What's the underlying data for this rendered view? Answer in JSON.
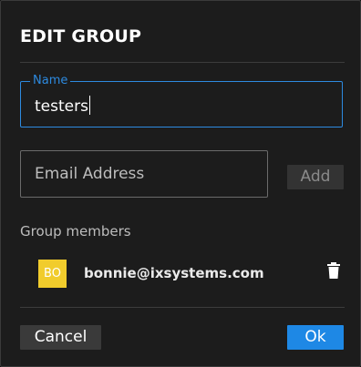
{
  "dialog": {
    "title": "EDIT GROUP"
  },
  "name_field": {
    "label": "Name",
    "value": "testers"
  },
  "email_field": {
    "placeholder": "Email Address",
    "value": ""
  },
  "add_button": {
    "label": "Add",
    "enabled": false
  },
  "members": {
    "label": "Group members",
    "items": [
      {
        "initials": "BO",
        "email": "bonnie@ixsystems.com",
        "avatar_color": "#f1cc2c",
        "delete_icon": "trash-icon"
      }
    ]
  },
  "footer": {
    "cancel_label": "Cancel",
    "ok_label": "Ok"
  },
  "colors": {
    "accent": "#1e88e5",
    "focus_outline": "#2d8ae0",
    "background": "#1c1c1c"
  }
}
